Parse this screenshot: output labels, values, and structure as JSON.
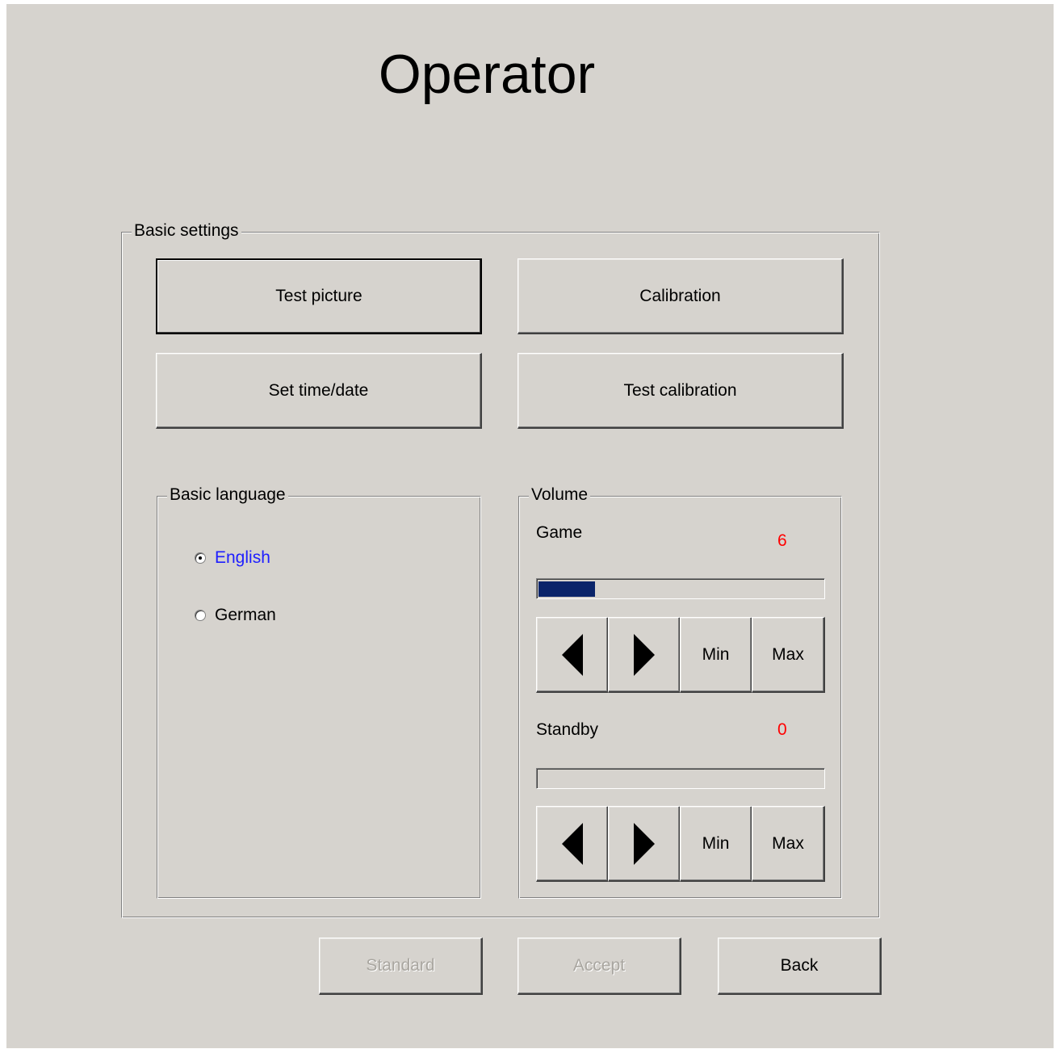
{
  "title": "Operator",
  "basic_settings": {
    "legend": "Basic settings",
    "buttons": {
      "test_picture": "Test picture",
      "calibration": "Calibration",
      "set_time_date": "Set time/date",
      "test_calibration": "Test calibration"
    }
  },
  "language": {
    "legend": "Basic language",
    "options": [
      {
        "label": "English",
        "selected": true,
        "color": "#1e1eff"
      },
      {
        "label": "German",
        "selected": false
      }
    ]
  },
  "volume": {
    "legend": "Volume",
    "game": {
      "label": "Game",
      "value": "6",
      "level_fraction": 0.2
    },
    "standby": {
      "label": "Standby",
      "value": "0",
      "level_fraction": 0
    },
    "controls": {
      "decrease_icon": "triangle-left-icon",
      "increase_icon": "triangle-right-icon",
      "min_label": "Min",
      "max_label": "Max"
    }
  },
  "footer": {
    "standard": "Standard",
    "accept": "Accept",
    "back": "Back"
  },
  "colors": {
    "background": "#d6d3ce",
    "value_red": "#ff0000",
    "bar_fill": "#0a246a",
    "selected_option": "#1e1eff"
  }
}
